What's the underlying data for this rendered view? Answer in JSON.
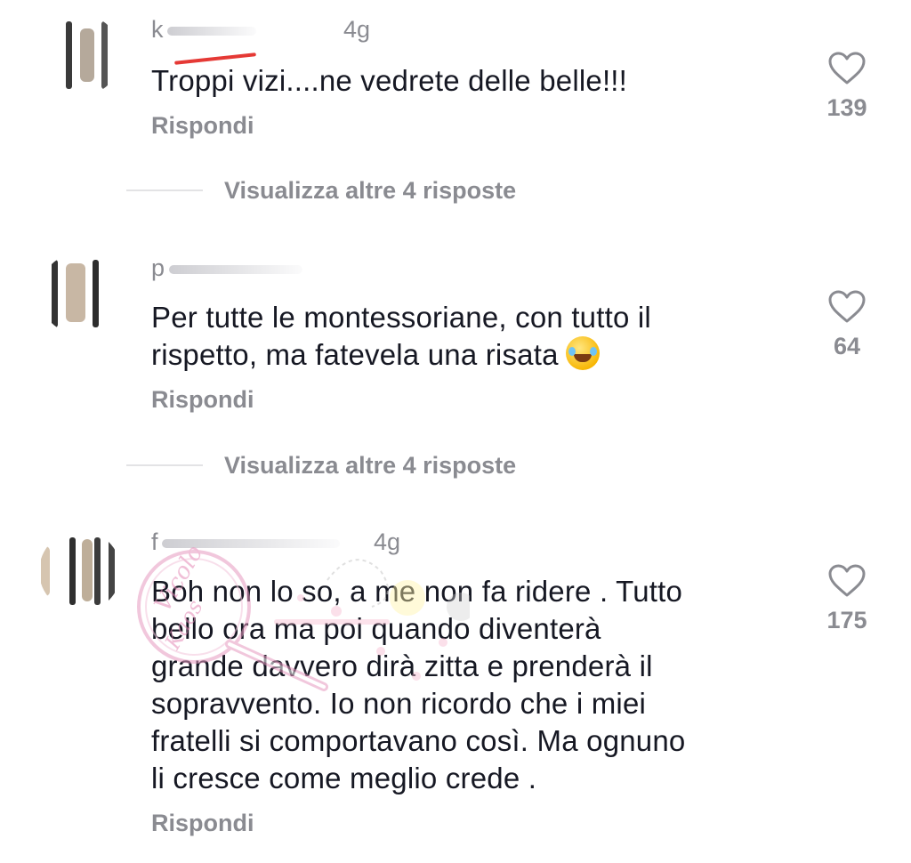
{
  "comments": [
    {
      "username": "k",
      "time": "4g",
      "text": "Troppi vizi....ne vedrete delle belle!!!",
      "reply_label": "Rispondi",
      "likes": "139",
      "view_more": "Visualizza altre 4 risposte"
    },
    {
      "username": "p",
      "time": "",
      "text": "Per tutte le montessoriane, con tutto il\nrispetto, ma fatevela una risata",
      "reply_label": "Rispondi",
      "likes": "64",
      "view_more": "Visualizza altre 4 risposte"
    },
    {
      "username": "f",
      "time": "4g",
      "text": "Boh non lo so, a me non fa ridere . Tutto\nbello ora ma poi quando diventerà\ngrande davvero dirà zitta e prenderà il\nsopravvento. Io non ricordo che i miei\nfratelli si comportavano così. Ma ognuno\nli cresce come meglio crede .",
      "reply_label": "Rispondi",
      "likes": "175"
    }
  ],
  "icons": {
    "like": "heart-outline-icon",
    "emoji": "tears-of-joy-emoji"
  },
  "colors": {
    "text": "#161823",
    "secondary": "#8a8b91",
    "divider": "#e3e3e5",
    "redaction": "#e53935"
  },
  "watermark": {
    "text": "Vicolo Kaos"
  }
}
